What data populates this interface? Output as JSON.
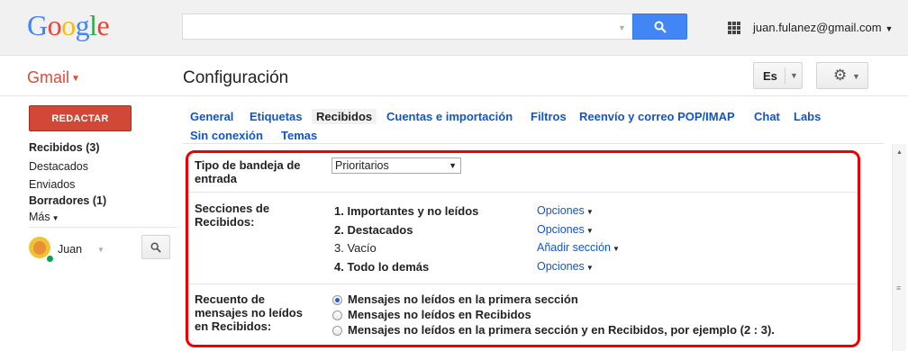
{
  "header": {
    "logo_letters": [
      {
        "ch": "G",
        "color": "#4285f4"
      },
      {
        "ch": "o",
        "color": "#ea4335"
      },
      {
        "ch": "o",
        "color": "#fbbc05"
      },
      {
        "ch": "g",
        "color": "#4285f4"
      },
      {
        "ch": "l",
        "color": "#34a853"
      },
      {
        "ch": "e",
        "color": "#ea4335"
      }
    ],
    "search_value": "",
    "account_email": "juan.fulanez@gmail.com",
    "search_button_color": "#4285f4"
  },
  "subheader": {
    "app_label": "Gmail",
    "page_title": "Configuración",
    "language_label": "Es"
  },
  "sidebar": {
    "compose_label": "REDACTAR",
    "items": [
      {
        "label": "Recibidos (3)",
        "bold": true
      },
      {
        "label": "Destacados",
        "bold": false
      },
      {
        "label": "Enviados",
        "bold": false
      },
      {
        "label": "Borradores (1)",
        "bold": true
      },
      {
        "label": "Más",
        "bold": false
      }
    ],
    "user_name": "Juan"
  },
  "tabs": [
    {
      "label": "General",
      "active": false
    },
    {
      "label": "Etiquetas",
      "active": false
    },
    {
      "label": "Recibidos",
      "active": true
    },
    {
      "label": "Cuentas e importación",
      "active": false
    },
    {
      "label": "Filtros",
      "active": false
    },
    {
      "label": "Reenvío y correo POP/IMAP",
      "active": false
    },
    {
      "label": "Chat",
      "active": false
    },
    {
      "label": "Labs",
      "active": false
    },
    {
      "label": "Sin conexión",
      "active": false
    },
    {
      "label": "Temas",
      "active": false
    }
  ],
  "settings": {
    "inbox_type": {
      "label": "Tipo de bandeja de entrada",
      "label_lines": [
        "Tipo de bandeja de",
        "entrada"
      ],
      "selected": "Prioritarios"
    },
    "sections": {
      "label_lines": [
        "Secciones de",
        "Recibidos:"
      ],
      "items": [
        {
          "label": "1. Importantes y no leídos",
          "bold": true,
          "action": "Opciones"
        },
        {
          "label": "2. Destacados",
          "bold": true,
          "action": "Opciones"
        },
        {
          "label": "3. Vacío",
          "bold": false,
          "action": "Añadir sección"
        },
        {
          "label": "4. Todo lo demás",
          "bold": true,
          "action": "Opciones"
        }
      ]
    },
    "unread_count": {
      "label_lines": [
        "Recuento de",
        "mensajes no leídos",
        "en Recibidos:"
      ],
      "options": [
        {
          "label": "Mensajes no leídos en la primera sección",
          "checked": true
        },
        {
          "label": "Mensajes no leídos en Recibidos",
          "checked": false
        },
        {
          "label": "Mensajes no leídos en la primera sección y en Recibidos, por ejemplo (2 : 3).",
          "checked": false
        }
      ]
    }
  },
  "highlight_color": "#e00000"
}
